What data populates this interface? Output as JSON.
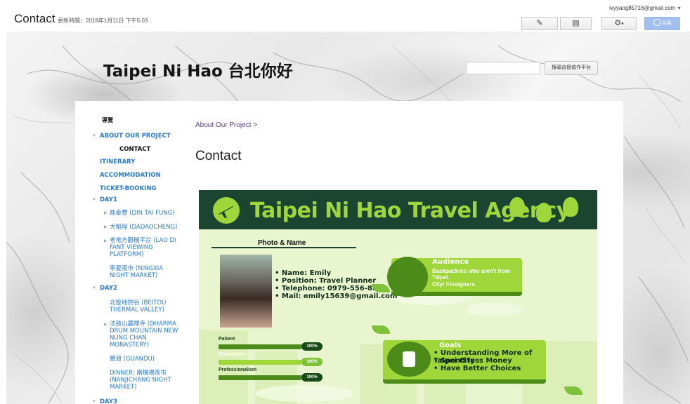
{
  "topbar": {
    "page_name": "Contact",
    "updated": "更新時間：2018年1月11日 下午5:03",
    "account": "ivyyang85716@gmail.com",
    "share_label": "共用"
  },
  "site": {
    "title": "Taipei Ni Hao 台北你好",
    "search_placeholder": "",
    "search_button": "搜尋這個協作平台"
  },
  "nav": {
    "title": "導覽",
    "items": [
      {
        "label": "ABOUT OUR PROJECT"
      },
      {
        "label": "CONTACT"
      },
      {
        "label": "ITINERARY"
      },
      {
        "label": "ACCOMMODATION"
      },
      {
        "label": "TICKET-BOOKING"
      },
      {
        "label": "DAY1"
      },
      {
        "label": "鼎泰豐 (DIN TAI FUNG)"
      },
      {
        "label": "大稻埕 (DADAOCHENG)"
      },
      {
        "label": "老地方觀機平台 (LAO DI FANT VIEWING PLATFORM)"
      },
      {
        "label": "寧夏夜市 (NINGXIA NIGHT MARKET)"
      },
      {
        "label": "DAY2"
      },
      {
        "label": "北投地熱谷 (BEITOU THERMAL VALLEY)"
      },
      {
        "label": "法鼓山農禪寺 (DHARMA DRUM MOUNTAIN NEW NUNG CHAN MONASTERY)"
      },
      {
        "label": "關渡 (GUANDU)"
      },
      {
        "label": "DINNER: 南機場夜市 (NANJICHANG NIGHT MARKET)"
      },
      {
        "label": "DAY3"
      }
    ]
  },
  "main": {
    "breadcrumb": "About Our Project",
    "breadcrumb_sep": ">",
    "heading": "Contact"
  },
  "poster": {
    "title": "Taipei Ni Hao Travel Agency",
    "photo_label": "Photo & Name",
    "info": [
      "• Name: Emily",
      "• Position: Travel Planner",
      "• Telephone: 0979-556-888",
      "• Mail: emily15639@gmail.com"
    ],
    "skills": [
      {
        "label": "Patient",
        "value": "100%"
      },
      {
        "label": "Enthusiasm",
        "value": "100%"
      },
      {
        "label": "Professionalism",
        "value": "100%"
      }
    ],
    "audience": {
      "title": "Audience",
      "lines": [
        "Backpackers who aren't from Taipei",
        "City/ Foreigners"
      ]
    },
    "goals": {
      "title": "Goals",
      "lines": [
        "• Understanding More of Taipei City",
        "• Spend less Money",
        "• Have Better Choices"
      ]
    }
  },
  "colors": {
    "link_blue": "#2a7bd0",
    "poster_dark_green": "#1b4530",
    "poster_lime": "#9fd63a"
  }
}
